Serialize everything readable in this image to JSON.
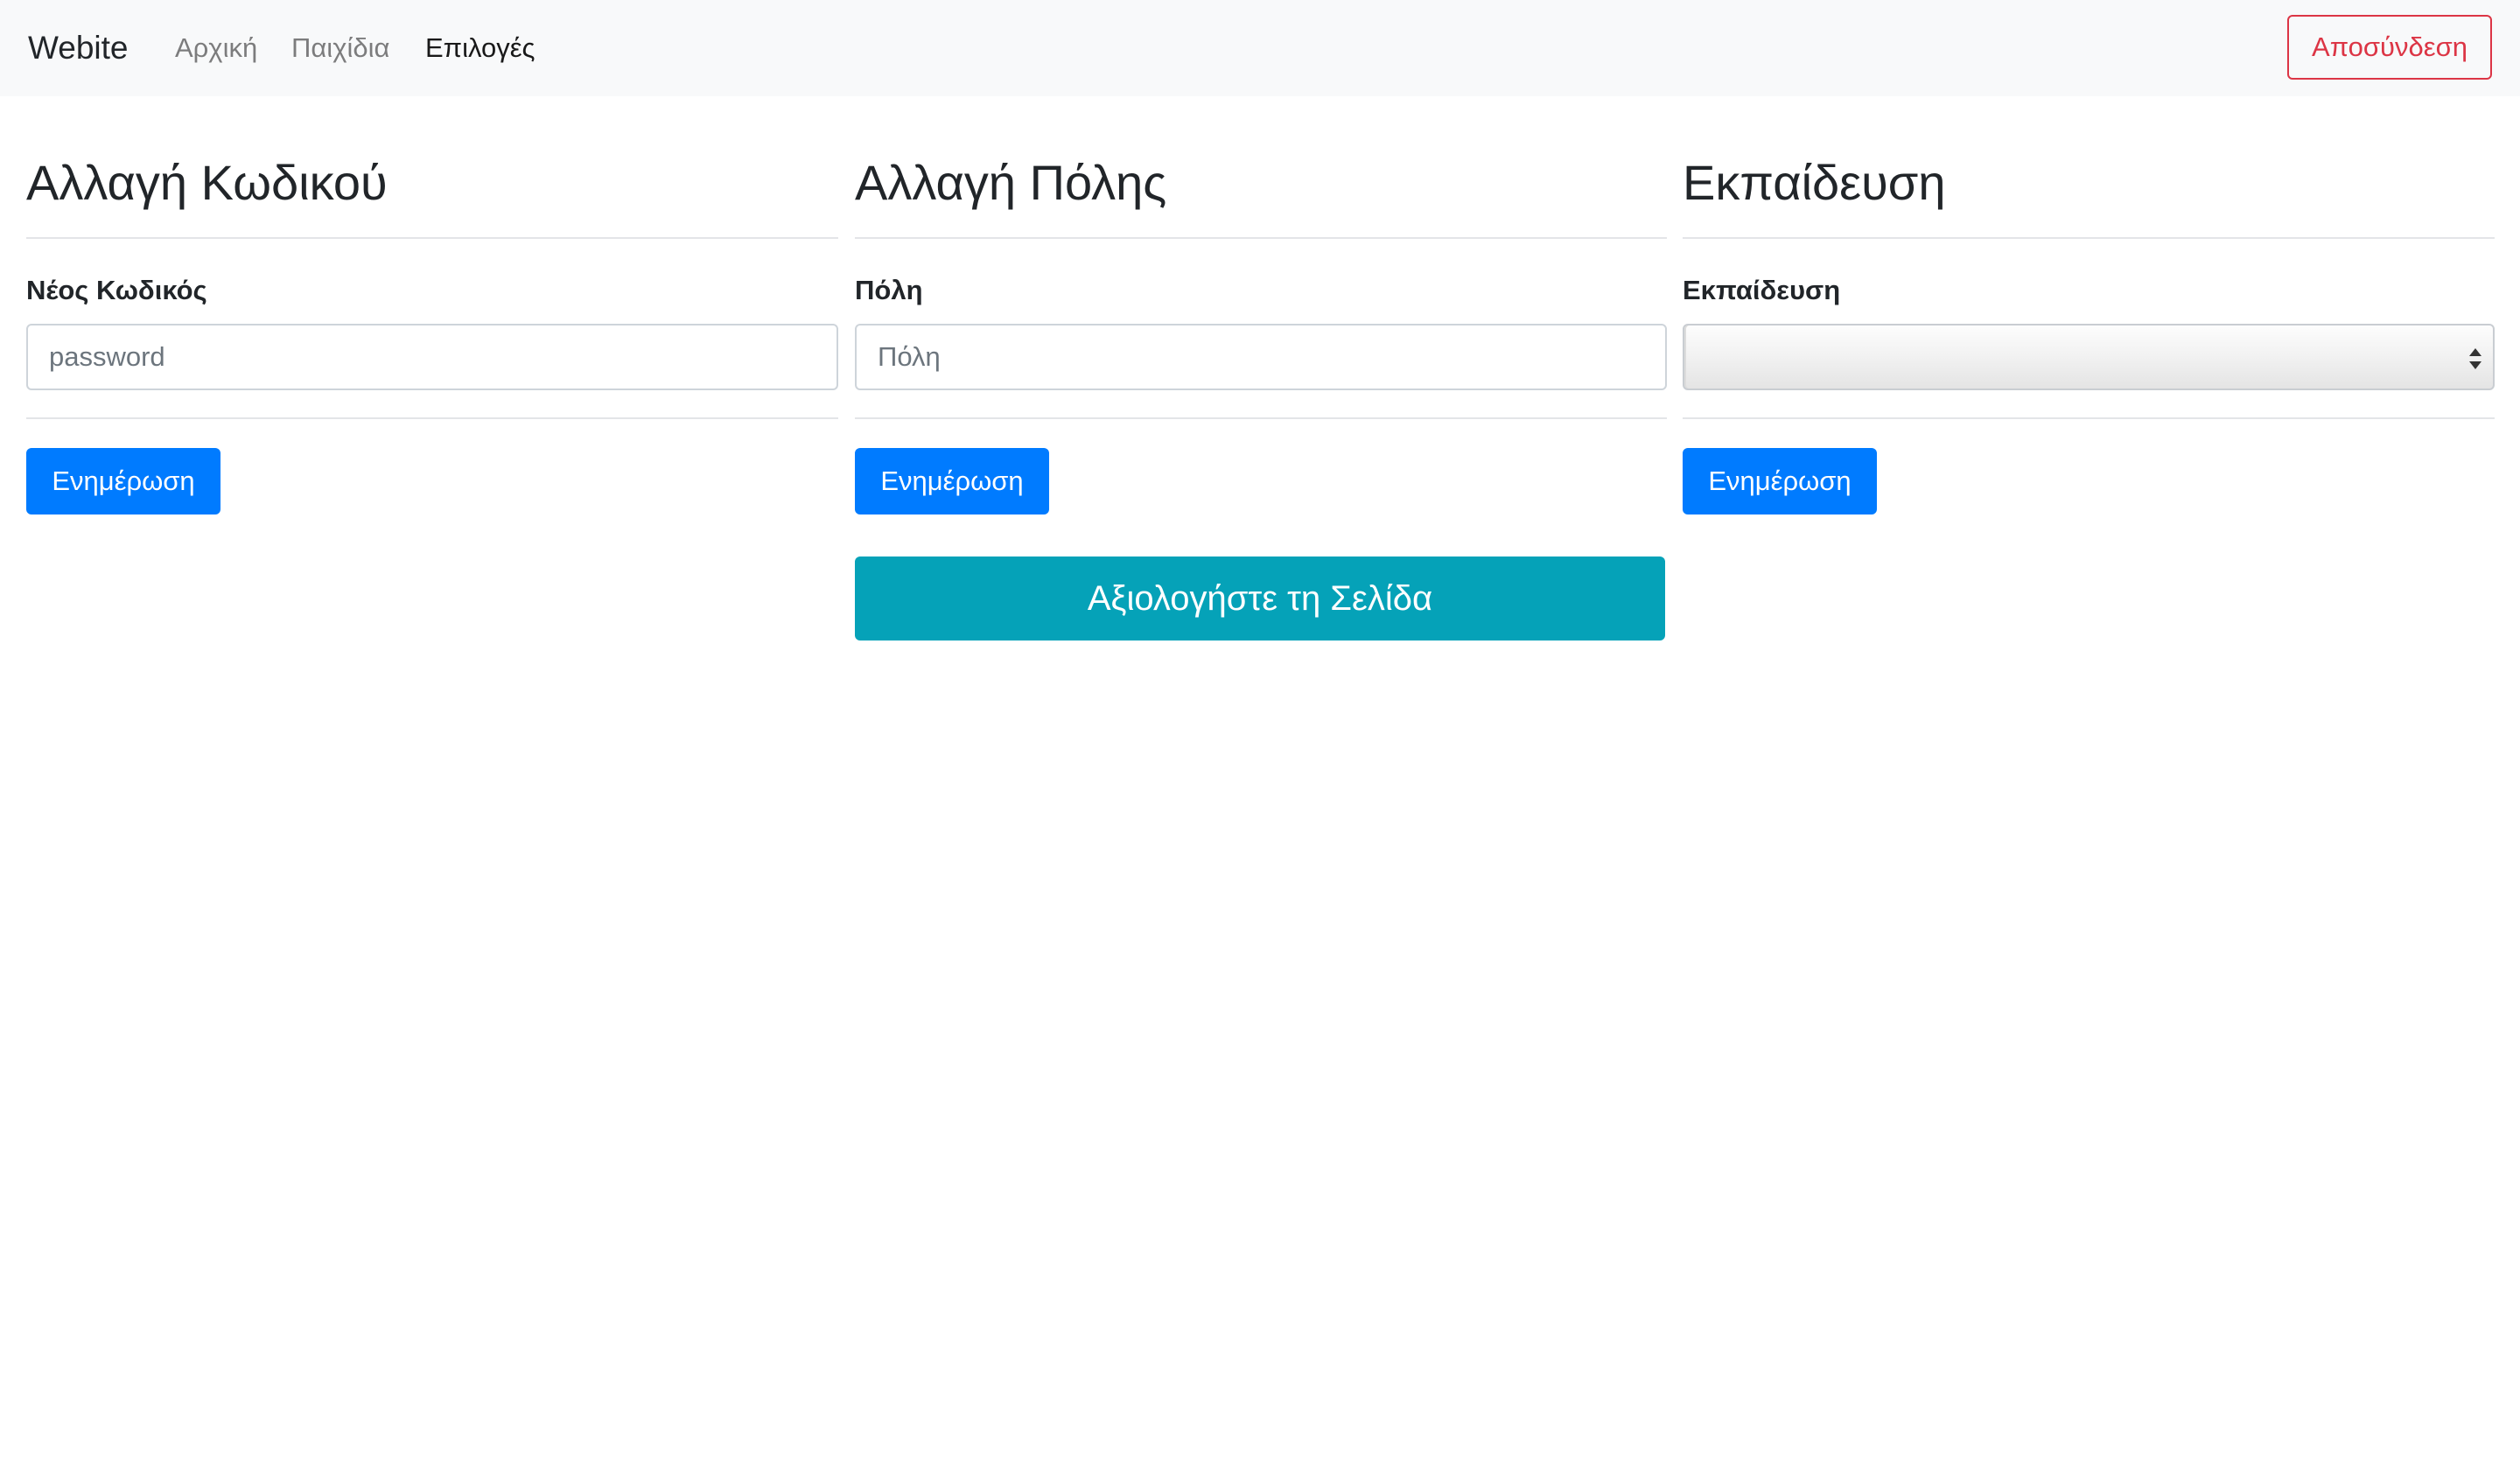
{
  "navbar": {
    "brand": "Webite",
    "links": [
      {
        "label": "Αρχική",
        "active": false
      },
      {
        "label": "Παιχίδια",
        "active": false
      },
      {
        "label": "Επιλογές",
        "active": true
      }
    ],
    "logout_label": "Αποσύνδεση"
  },
  "sections": [
    {
      "title": "Αλλαγή Κωδικού",
      "label": "Νέος Κωδικός",
      "input_placeholder": "password",
      "input_value": "",
      "button_label": "Ενημέρωση"
    },
    {
      "title": "Αλλαγή Πόλης",
      "label": "Πόλη",
      "input_placeholder": "Πόλη",
      "input_value": "",
      "button_label": "Ενημέρωση"
    },
    {
      "title": "Εκπαίδευση",
      "label": "Εκπαίδευση",
      "select_value": "",
      "button_label": "Ενημέρωση"
    }
  ],
  "rate_button_label": "Αξιολογήστε τη Σελίδα",
  "colors": {
    "primary": "#007bff",
    "info": "#05a2b8",
    "danger": "#dc3545",
    "navbar_bg": "#f8f9fa",
    "text": "#212529"
  }
}
